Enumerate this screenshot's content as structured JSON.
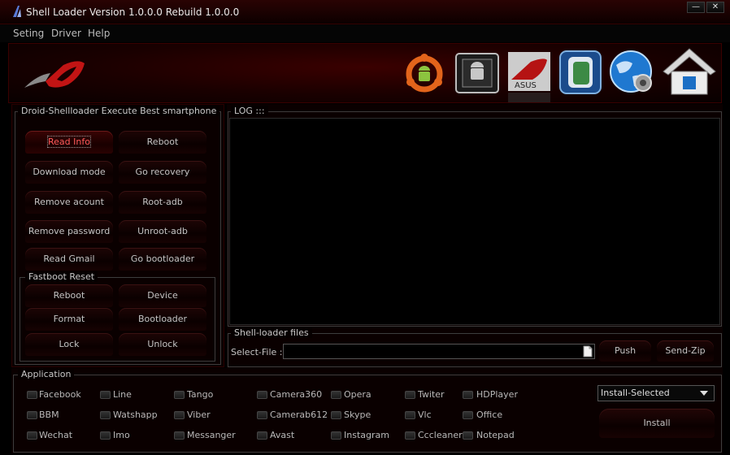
{
  "window": {
    "title": "Shell Loader Version 1.0.0.0 Rebuild 1.0.0.0",
    "minimize": "—",
    "close": "✕"
  },
  "menu": [
    "Seting",
    "Driver",
    "Help"
  ],
  "toolbar_icons": [
    "ubuntu-android-icon",
    "chip-android-icon",
    "asus-rog-icon",
    "window-icon",
    "globe-gear-icon",
    "home-icon"
  ],
  "left_group": {
    "title": "Droid-Shellloader Execute Best smartphone",
    "buttons": [
      "Read Info",
      "Reboot",
      "Download mode",
      "Go recovery",
      "Remove acount",
      "Root-adb",
      "Remove password",
      "Unroot-adb",
      "Read Gmail",
      "Go bootloader"
    ]
  },
  "fastboot": {
    "title": "Fastboot Reset",
    "buttons": [
      "Reboot",
      "Device",
      "Format",
      "Bootloader",
      "Lock",
      "Unlock"
    ]
  },
  "log": {
    "title": "LOG :::"
  },
  "files": {
    "title": "Shell-loader files",
    "select_label": "Select-File :",
    "push": "Push",
    "send_zip": "Send-Zip"
  },
  "application": {
    "title": "Application",
    "apps": [
      "Facebook",
      "Line",
      "Tango",
      "Camera360",
      "Opera",
      "Twiter",
      "HDPlayer",
      "BBM",
      "Watshapp",
      "Viber",
      "Camerab612",
      "Skype",
      "Vlc",
      "Office",
      "Wechat",
      "Imo",
      "Messanger",
      "Avast",
      "Instagram",
      "Cccleaner",
      "Notepad"
    ],
    "select_value": "Install-Selected",
    "install": "Install"
  },
  "colors": {
    "accent": "#ff3b3b",
    "panel": "#0a0000",
    "banner": "#3a0000"
  }
}
